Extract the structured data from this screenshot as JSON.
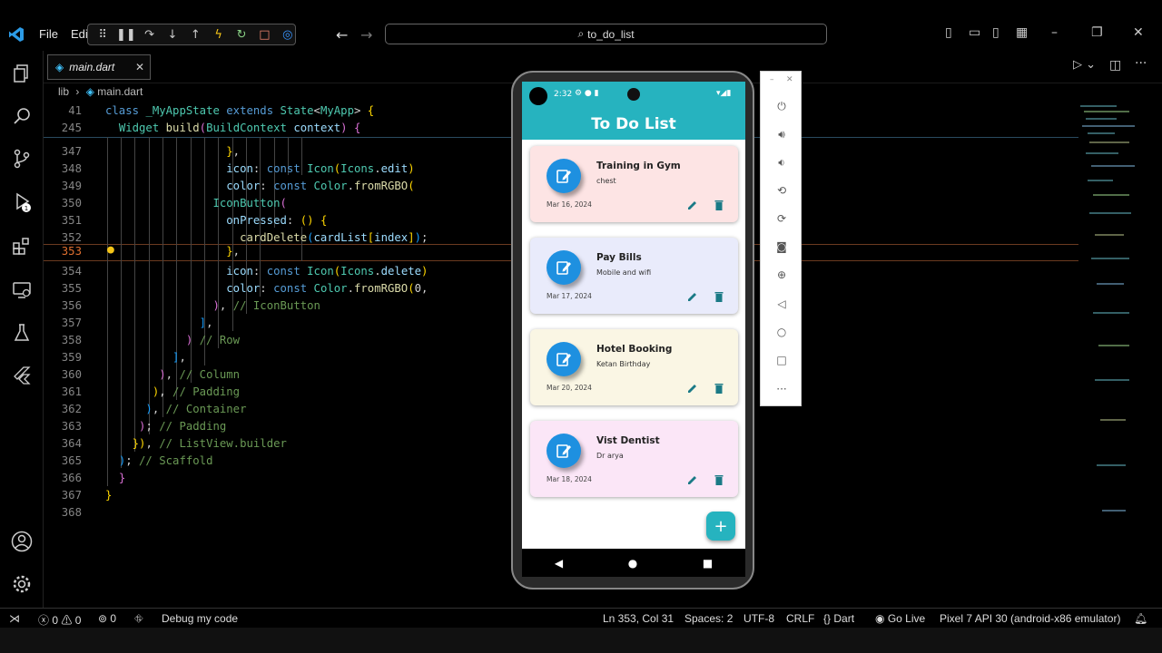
{
  "menu": {
    "file": "File",
    "edit": "Edi"
  },
  "search": {
    "text": "to_do_list"
  },
  "tab": {
    "label": "main.dart",
    "close": "✕"
  },
  "breadcrumb": {
    "folder": "lib",
    "file": "main.dart"
  },
  "sticky": [
    {
      "line": "41",
      "text": "class _MyAppState extends State<MyApp> {"
    },
    {
      "line": "245",
      "text": "  Widget build(BuildContext context) {"
    }
  ],
  "code_lines": [
    {
      "line": "347",
      "text": "                  },"
    },
    {
      "line": "348",
      "text": "                  icon: const Icon(Icons.edit)"
    },
    {
      "line": "349",
      "text": "                  color: const Color.fromRGBO("
    },
    {
      "line": "350",
      "text": "                IconButton("
    },
    {
      "line": "351",
      "text": "                  onPressed: () {"
    },
    {
      "line": "352",
      "text": "                    cardDelete(cardList[index]);"
    },
    {
      "line": "353",
      "text": "                  },"
    },
    {
      "line": "354",
      "text": "                  icon: const Icon(Icons.delete)"
    },
    {
      "line": "355",
      "text": "                  color: const Color.fromRGBO(0,"
    },
    {
      "line": "356",
      "text": "                ), // IconButton"
    },
    {
      "line": "357",
      "text": "              ],"
    },
    {
      "line": "358",
      "text": "            ) // Row"
    },
    {
      "line": "359",
      "text": "          ],"
    },
    {
      "line": "360",
      "text": "        ), // Column"
    },
    {
      "line": "361",
      "text": "      ), // Padding"
    },
    {
      "line": "362",
      "text": "    ), // Container"
    },
    {
      "line": "363",
      "text": "  ); // Padding"
    },
    {
      "line": "364",
      "text": "  }), // ListView.builder"
    },
    {
      "line": "365",
      "text": "  ); // Scaffold"
    },
    {
      "line": "366",
      "text": "  }"
    },
    {
      "line": "367",
      "text": "}"
    },
    {
      "line": "368",
      "text": ""
    }
  ],
  "status": {
    "errors": "0",
    "warnings": "0",
    "ports": "0",
    "debug": "Debug my code",
    "position": "Ln 353, Col 31",
    "spaces": "Spaces: 2",
    "encoding": "UTF-8",
    "eol": "CRLF",
    "language": "Dart",
    "golive": "Go Live",
    "device": "Pixel 7 API 30 (android-x86 emulator)"
  },
  "phone": {
    "time": "2:32",
    "app_title": "To Do List",
    "fab": "+",
    "cards": [
      {
        "title": "Training in Gym",
        "subtitle": "chest",
        "date": "Mar 16, 2024",
        "color": "#fde4e4"
      },
      {
        "title": "Pay Bills",
        "subtitle": "Mobile and wifi",
        "date": "Mar 17, 2024",
        "color": "#e9ebfb"
      },
      {
        "title": "Hotel Booking",
        "subtitle": "Ketan Birthday",
        "date": "Mar 20, 2024",
        "color": "#faf6e4"
      },
      {
        "title": "Vist Dentist",
        "subtitle": "Dr arya",
        "date": "Mar 18, 2024",
        "color": "#fbe6f7"
      }
    ]
  },
  "colors": {
    "accent": "#26b3bf",
    "icon_blue": "#1e90e0",
    "action": "#1a7a86"
  }
}
